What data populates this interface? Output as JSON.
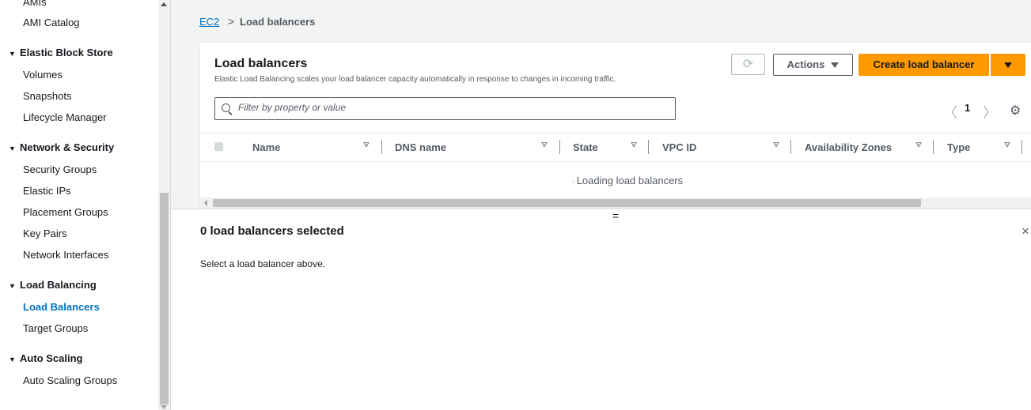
{
  "sidebar": {
    "items_top": [
      {
        "label": "AMIs"
      },
      {
        "label": "AMI Catalog"
      }
    ],
    "sections": [
      {
        "title": "Elastic Block Store",
        "items": [
          "Volumes",
          "Snapshots",
          "Lifecycle Manager"
        ]
      },
      {
        "title": "Network & Security",
        "items": [
          "Security Groups",
          "Elastic IPs",
          "Placement Groups",
          "Key Pairs",
          "Network Interfaces"
        ]
      },
      {
        "title": "Load Balancing",
        "items": [
          "Load Balancers",
          "Target Groups"
        ]
      },
      {
        "title": "Auto Scaling",
        "items": [
          "Auto Scaling Groups"
        ]
      }
    ],
    "active_item": "Load Balancers"
  },
  "breadcrumb": {
    "root": "EC2",
    "separator": ">",
    "current": "Load balancers"
  },
  "panel": {
    "title": "Load balancers",
    "description": "Elastic Load Balancing scales your load balancer capacity automatically in response to changes in incoming traffic.",
    "refresh_icon": "refresh-icon",
    "actions_label": "Actions",
    "create_label": "Create load balancer",
    "filter_placeholder": "Filter by property or value",
    "pagination": {
      "prev": "<",
      "page": "1",
      "next": ">"
    },
    "columns": [
      "Name",
      "DNS name",
      "State",
      "VPC ID",
      "Availability Zones",
      "Type"
    ],
    "loading_text": "Loading load balancers"
  },
  "split_handle": "=",
  "details": {
    "title": "0 load balancers selected",
    "close": "×",
    "message": "Select a load balancer above."
  },
  "colors": {
    "accent": "#0073bb",
    "primary_button": "#ff9900"
  }
}
